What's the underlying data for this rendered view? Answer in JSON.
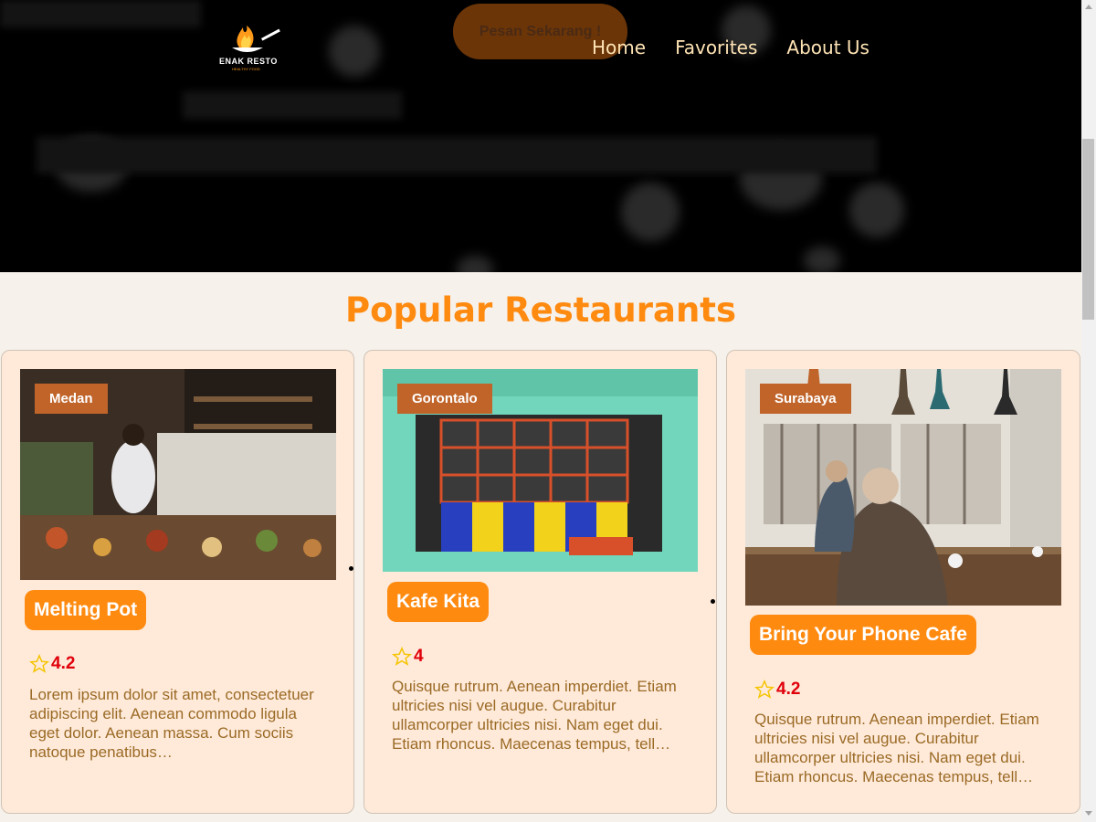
{
  "hero": {
    "cta_label": "Pesan Sekarang !"
  },
  "brand": {
    "name": "ENAK RESTO",
    "tagline": "HEALTHY FOOD"
  },
  "nav": {
    "items": [
      "Home",
      "Favorites",
      "About Us"
    ]
  },
  "section": {
    "title": "Popular Restaurants"
  },
  "restaurants": [
    {
      "city": "Medan",
      "name": "Melting Pot",
      "rating": "4.2",
      "description": "Lorem ipsum dolor sit amet, consectetuer adipiscing elit. Aenean commodo ligula eget dolor. Aenean massa. Cum sociis natoque penatibus…"
    },
    {
      "city": "Gorontalo",
      "name": "Kafe Kita",
      "rating": "4",
      "description": "Quisque rutrum. Aenean imperdiet. Etiam ultricies nisi vel augue. Curabitur ullamcorper ultricies nisi. Nam eget dui. Etiam rhoncus. Maecenas tempus, tell…"
    },
    {
      "city": "Surabaya",
      "name": "Bring Your Phone Cafe",
      "rating": "4.2",
      "description": "Quisque rutrum. Aenean imperdiet. Etiam ultricies nisi vel augue. Curabitur ullamcorper ultricies nisi. Nam eget dui. Etiam rhoncus. Maecenas tempus, tell…"
    }
  ],
  "colors": {
    "accent": "#ff8a10",
    "city_badge": "#c0642a",
    "rating": "#e0000a",
    "card_bg": "#ffeada"
  }
}
